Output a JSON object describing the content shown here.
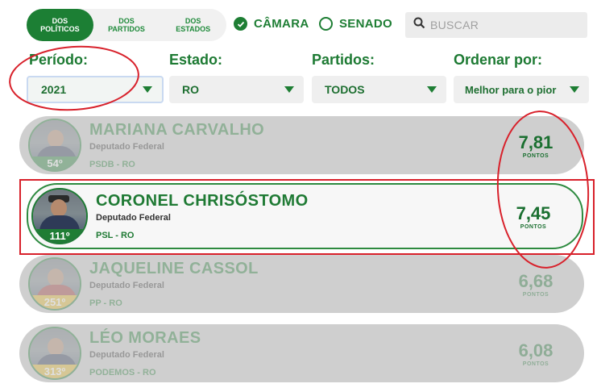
{
  "tabs": [
    {
      "label": "DOS\nPOLÍTICOS",
      "active": true
    },
    {
      "label": "DOS\nPARTIDOS",
      "active": false
    },
    {
      "label": "DOS\nESTADOS",
      "active": false
    }
  ],
  "house": {
    "camara_label": "CÂMARA",
    "senado_label": "SENADO",
    "selected": "camara"
  },
  "search": {
    "placeholder": "BUSCAR"
  },
  "filters": {
    "periodo": {
      "label": "Período:",
      "value": "2021"
    },
    "estado": {
      "label": "Estado:",
      "value": "RO"
    },
    "partidos": {
      "label": "Partidos:",
      "value": "TODOS"
    },
    "ordenar": {
      "label": "Ordenar por:",
      "value": "Melhor para o pior"
    }
  },
  "politicians": [
    {
      "name": "MARIANA CARVALHO",
      "role": "Deputado Federal",
      "party": "PSDB - RO",
      "rank": "54º",
      "score": "7,81",
      "score_label": "PONTOS",
      "highlighted": false
    },
    {
      "name": "CORONEL CHRISÓSTOMO",
      "role": "Deputado Federal",
      "party": "PSL - RO",
      "rank": "111º",
      "score": "7,45",
      "score_label": "PONTOS",
      "highlighted": true
    },
    {
      "name": "JAQUELINE CASSOL",
      "role": "Deputado Federal",
      "party": "PP - RO",
      "rank": "251º",
      "score": "6,68",
      "score_label": "PONTOS",
      "highlighted": false
    },
    {
      "name": "LÉO MORAES",
      "role": "Deputado Federal",
      "party": "PODEMOS - RO",
      "rank": "313º",
      "score": "6,08",
      "score_label": "PONTOS",
      "highlighted": false
    }
  ],
  "colors": {
    "brand_green": "#1c7f34",
    "annotation_red": "#d8212b",
    "rank_yellow": "#e3b92c"
  }
}
